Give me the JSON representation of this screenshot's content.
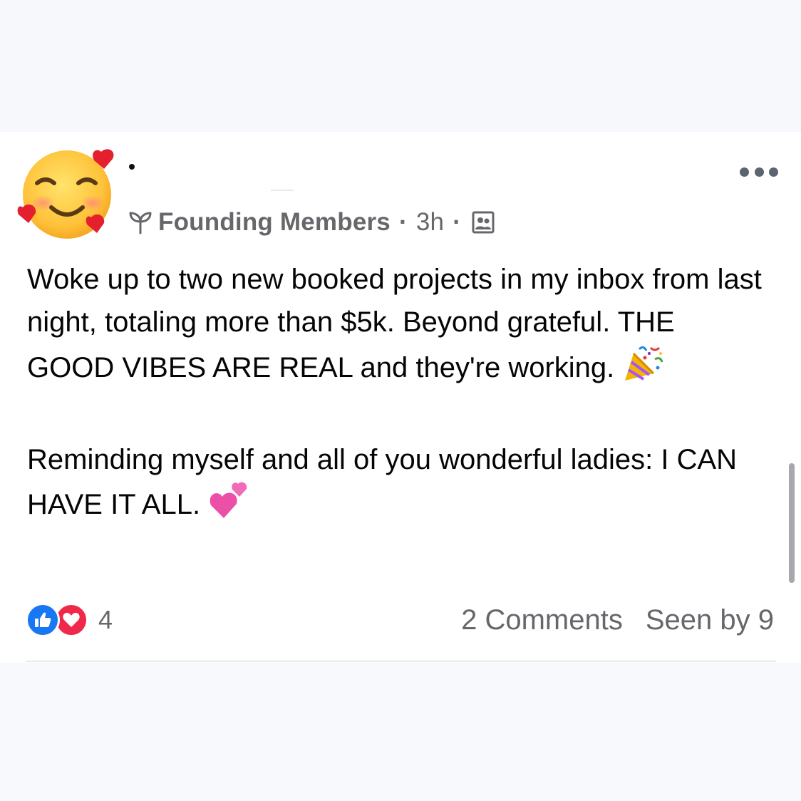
{
  "post": {
    "author_name": ".",
    "group_name": "Founding Members",
    "separator": "·",
    "timestamp": "3h",
    "body_line_1": "Woke up to two new booked projects in my inbox from last night, totaling more than $5k. Beyond grateful. THE GOOD VIBES ARE REAL and they're working.",
    "body_line_2": "Reminding myself and all of you wonderful ladies: I CAN HAVE IT ALL.",
    "avatar_icon": "smiling-face-with-hearts-emoji",
    "emoji_1": "party-popper-emoji",
    "emoji_2": "two-hearts-emoji",
    "audience_icon": "group-members-icon"
  },
  "footer": {
    "reaction_count": "4",
    "comments": "2 Comments",
    "seen_by": "Seen by 9"
  },
  "colors": {
    "text": "#050505",
    "meta": "#65676b",
    "like_blue": "#1877f2",
    "love_red": "#f0284a"
  }
}
